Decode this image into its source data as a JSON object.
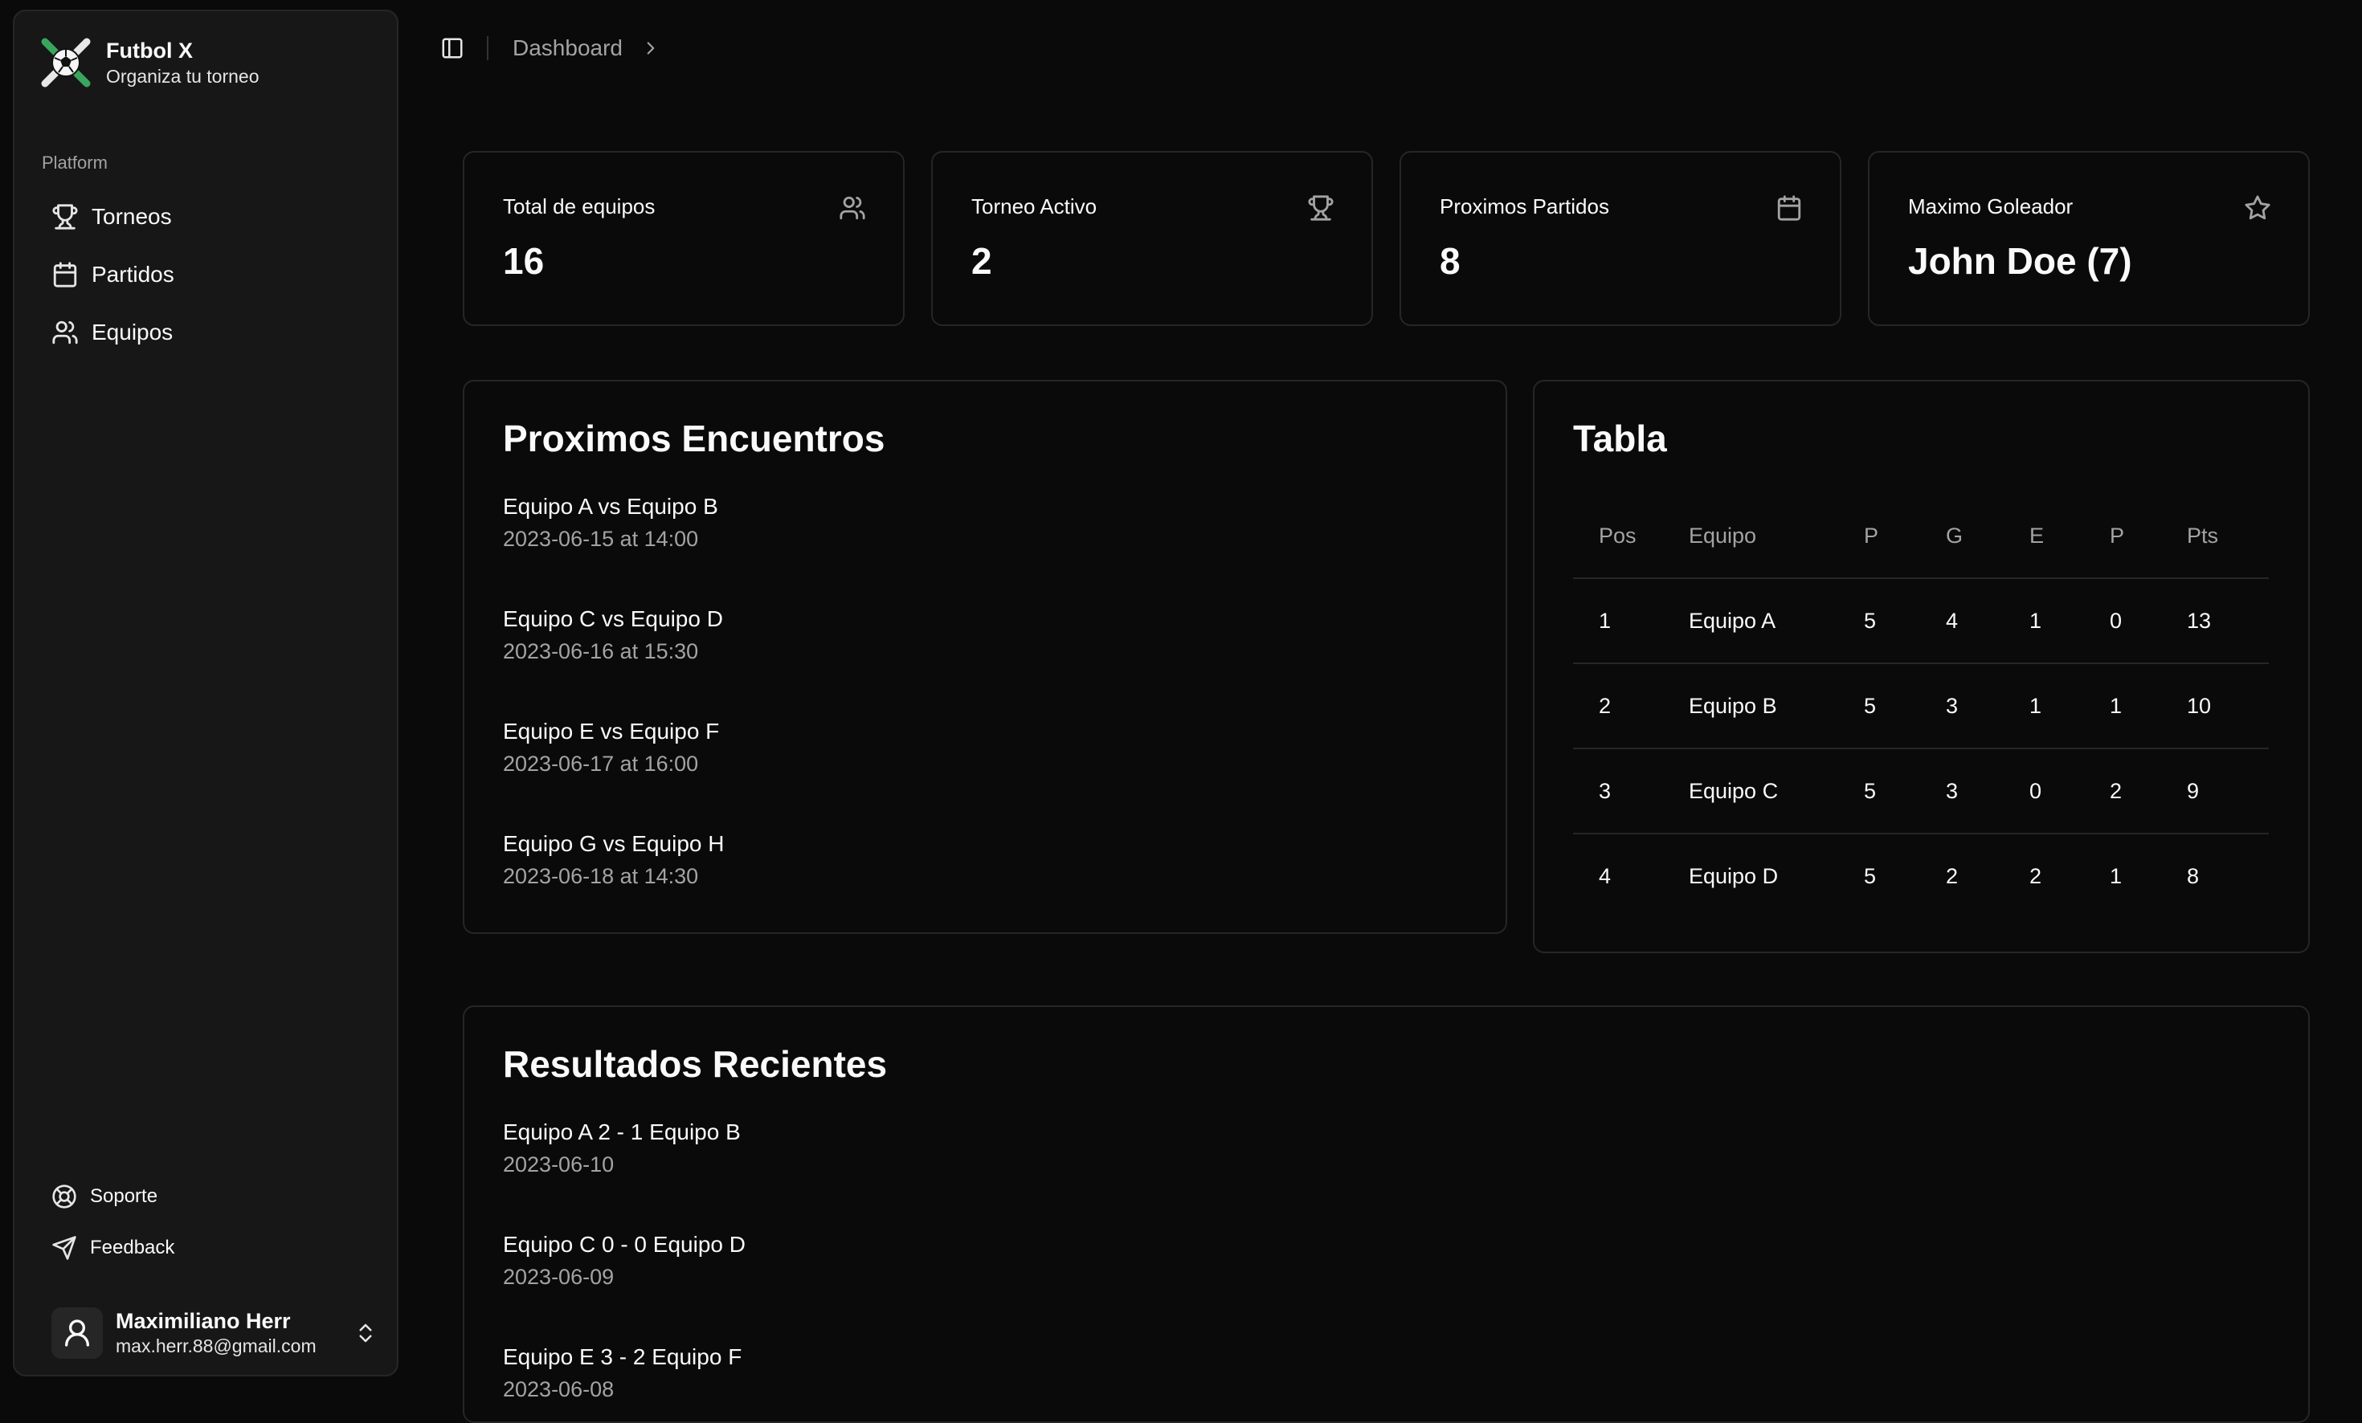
{
  "brand": {
    "name": "Futbol X",
    "tagline": "Organiza tu torneo"
  },
  "sidebar": {
    "group_label": "Platform",
    "items": [
      {
        "label": "Torneos",
        "icon": "trophy-icon"
      },
      {
        "label": "Partidos",
        "icon": "calendar-icon"
      },
      {
        "label": "Equipos",
        "icon": "users-icon"
      }
    ],
    "secondary": [
      {
        "label": "Soporte",
        "icon": "life-buoy-icon"
      },
      {
        "label": "Feedback",
        "icon": "send-icon"
      }
    ],
    "user": {
      "name": "Maximiliano Herr",
      "email": "max.herr.88@gmail.com"
    }
  },
  "header": {
    "breadcrumb": "Dashboard"
  },
  "stats": [
    {
      "title": "Total de equipos",
      "value": "16",
      "icon": "users-icon"
    },
    {
      "title": "Torneo Activo",
      "value": "2",
      "icon": "trophy-icon"
    },
    {
      "title": "Proximos Partidos",
      "value": "8",
      "icon": "calendar-icon"
    },
    {
      "title": "Maximo Goleador",
      "value": "John Doe (7)",
      "icon": "star-icon"
    }
  ],
  "upcoming": {
    "title": "Proximos Encuentros",
    "matches": [
      {
        "title": "Equipo A vs Equipo B",
        "date": "2023-06-15 at 14:00"
      },
      {
        "title": "Equipo C vs Equipo D",
        "date": "2023-06-16 at 15:30"
      },
      {
        "title": "Equipo E vs Equipo F",
        "date": "2023-06-17 at 16:00"
      },
      {
        "title": "Equipo G vs Equipo H",
        "date": "2023-06-18 at 14:30"
      }
    ]
  },
  "standings": {
    "title": "Tabla",
    "columns": [
      "Pos",
      "Equipo",
      "P",
      "G",
      "E",
      "P",
      "Pts"
    ],
    "rows": [
      [
        "1",
        "Equipo A",
        "5",
        "4",
        "1",
        "0",
        "13"
      ],
      [
        "2",
        "Equipo B",
        "5",
        "3",
        "1",
        "1",
        "10"
      ],
      [
        "3",
        "Equipo C",
        "5",
        "3",
        "0",
        "2",
        "9"
      ],
      [
        "4",
        "Equipo D",
        "5",
        "2",
        "2",
        "1",
        "8"
      ]
    ]
  },
  "recent": {
    "title": "Resultados Recientes",
    "results": [
      {
        "title": "Equipo A 2 - 1 Equipo B",
        "date": "2023-06-10"
      },
      {
        "title": "Equipo C 0 - 0 Equipo D",
        "date": "2023-06-09"
      },
      {
        "title": "Equipo E 3 - 2 Equipo F",
        "date": "2023-06-08"
      }
    ]
  }
}
